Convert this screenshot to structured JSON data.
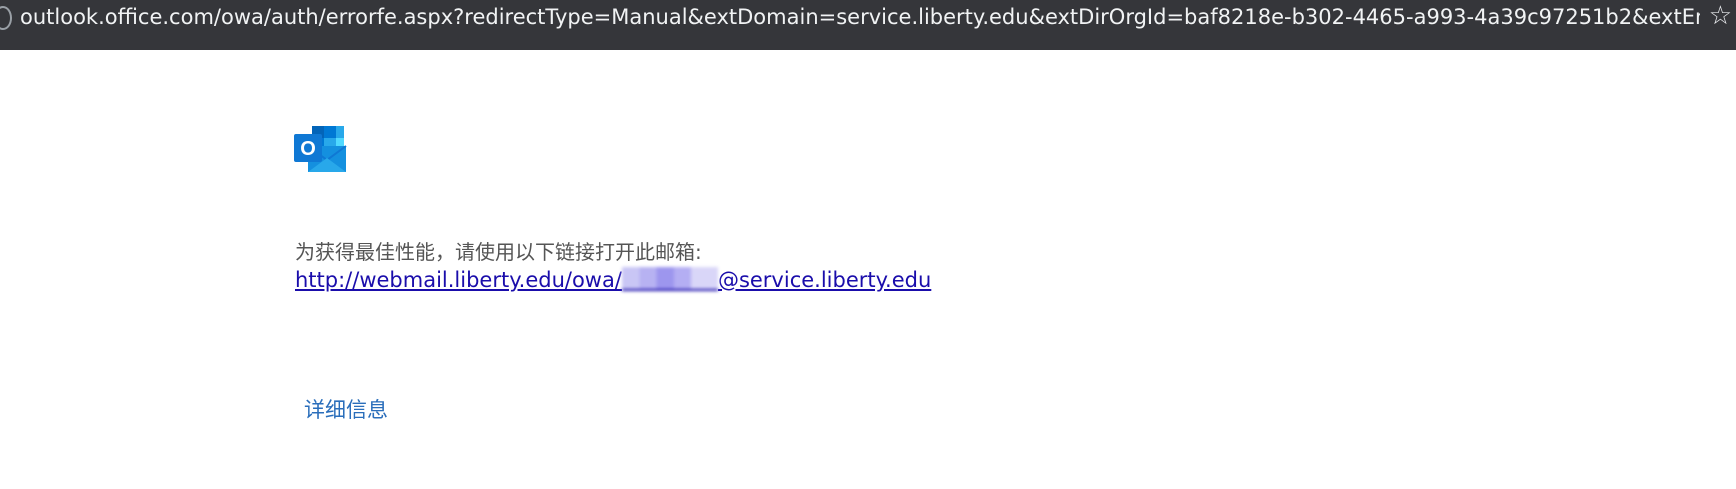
{
  "browser": {
    "url": "outlook.office.com/owa/auth/errorfe.aspx?redirectType=Manual&extDomain=service.liberty.edu&extDirOrgId=baf8218e-b302-4465-a993-4a39c97251b2&extEmail...",
    "star_icon": "☆"
  },
  "page": {
    "logo_icon": "outlook-logo-icon",
    "logo_letter": "O",
    "message": "为获得最佳性能，请使用以下链接打开此邮箱:",
    "link_prefix": "http://webmail.liberty.edu/owa/",
    "link_suffix": "@service.liberty.edu",
    "details_label": "详细信息"
  },
  "colors": {
    "outlook_blue": "#0f78d4",
    "link": "#1a0dab",
    "details_link": "#2a6ebb"
  }
}
